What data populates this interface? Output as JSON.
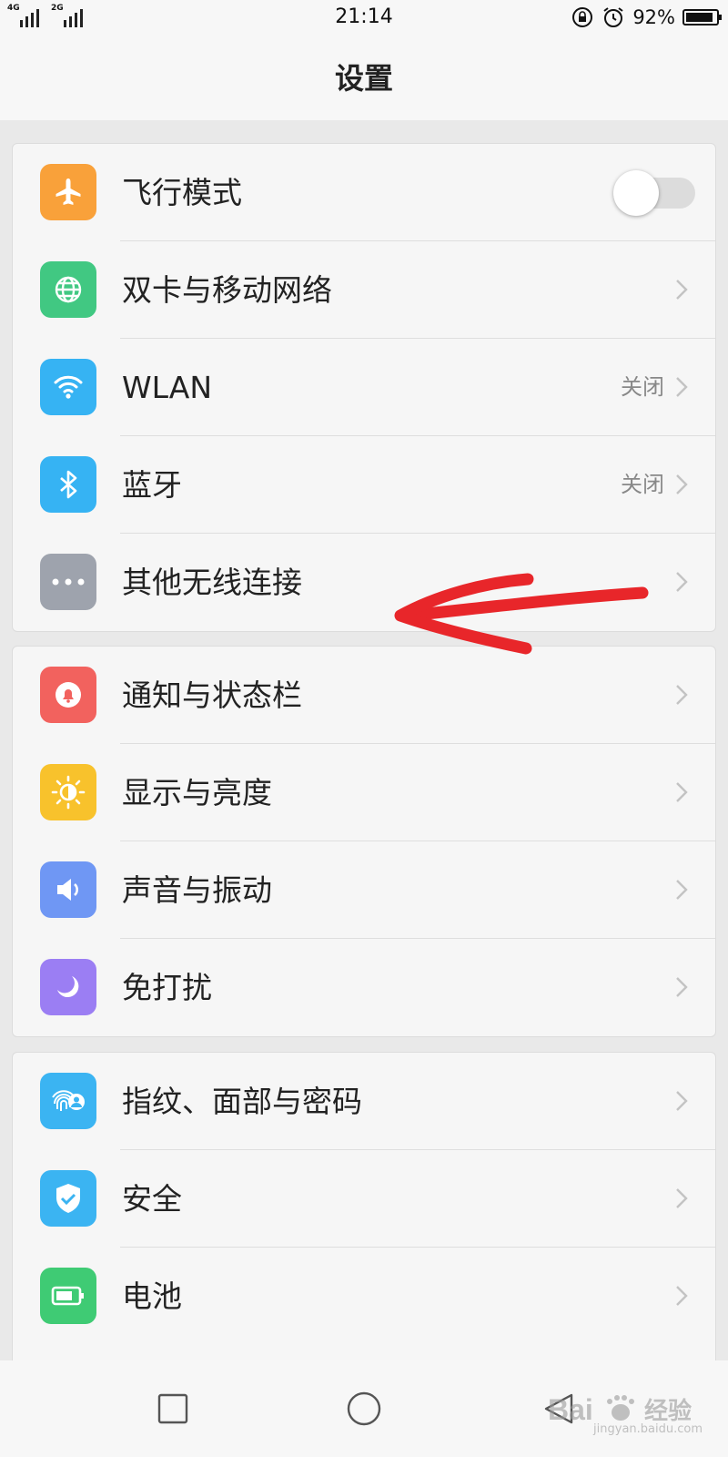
{
  "status_bar": {
    "network1": "4G",
    "network2": "2G",
    "time": "21:14",
    "battery_percent": "92%",
    "battery_level": 0.92,
    "icons": [
      "rotation-lock-icon",
      "alarm-icon",
      "battery-icon"
    ]
  },
  "title": "设置",
  "groups": [
    [
      {
        "label": "飞行模式",
        "icon": "airplane-icon",
        "color": "#f9a13a",
        "control": "toggle",
        "toggle_on": false
      },
      {
        "label": "双卡与移动网络",
        "icon": "globe-icon",
        "color": "#41c882",
        "control": "chevron"
      },
      {
        "label": "WLAN",
        "icon": "wifi-icon",
        "color": "#36b3f3",
        "control": "chevron",
        "value": "关闭"
      },
      {
        "label": "蓝牙",
        "icon": "bluetooth-icon",
        "color": "#36b3f3",
        "control": "chevron",
        "value": "关闭"
      },
      {
        "label": "其他无线连接",
        "icon": "more-dots-icon",
        "color": "#9ea3ad",
        "control": "chevron"
      }
    ],
    [
      {
        "label": "通知与状态栏",
        "icon": "bell-icon",
        "color": "#f2625e",
        "control": "chevron"
      },
      {
        "label": "显示与亮度",
        "icon": "sun-icon",
        "color": "#f8c22c",
        "control": "chevron"
      },
      {
        "label": "声音与振动",
        "icon": "speaker-icon",
        "color": "#6f97f4",
        "control": "chevron"
      },
      {
        "label": "免打扰",
        "icon": "moon-icon",
        "color": "#9b7ef3",
        "control": "chevron"
      }
    ],
    [
      {
        "label": "指纹、面部与密码",
        "icon": "fingerprint-face-icon",
        "color": "#3bb4f2",
        "control": "chevron"
      },
      {
        "label": "安全",
        "icon": "shield-check-icon",
        "color": "#3bb4f2",
        "control": "chevron"
      },
      {
        "label": "电池",
        "icon": "battery-setting-icon",
        "color": "#3fcb74",
        "control": "chevron"
      }
    ]
  ],
  "navbar": {
    "icons": [
      "recents-icon",
      "home-icon",
      "back-icon"
    ]
  },
  "annotation": {
    "color": "#e8262a",
    "points_to": "其他无线连接"
  },
  "watermark": {
    "text": "经验",
    "subtext": "jingyan.baidu.com"
  }
}
